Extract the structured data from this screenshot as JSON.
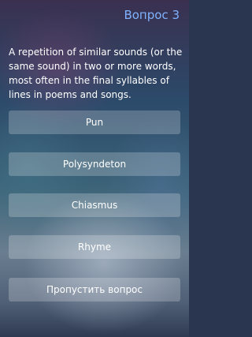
{
  "header": {
    "title": "Вопрос 3"
  },
  "question": {
    "text": "A repetition of similar sounds (or the same sound) in two or more words, most often in the final syllables of lines in poems and songs."
  },
  "answers": [
    {
      "label": "Pun"
    },
    {
      "label": "Polysyndeton"
    },
    {
      "label": "Chiasmus"
    },
    {
      "label": "Rhyme"
    }
  ],
  "skip": {
    "label": "Пропустить вопрос"
  },
  "colors": {
    "accent": "#7fb3ff",
    "text": "#ffffff"
  }
}
